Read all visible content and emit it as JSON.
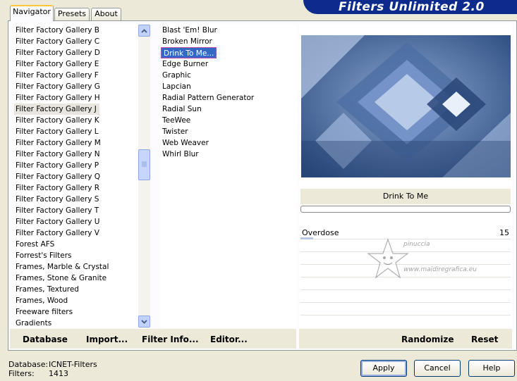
{
  "tabs": [
    "Navigator",
    "Presets",
    "About"
  ],
  "brand": "Filters Unlimited 2.0",
  "categories": [
    "Filter Factory Gallery B",
    "Filter Factory Gallery C",
    "Filter Factory Gallery D",
    "Filter Factory Gallery E",
    "Filter Factory Gallery F",
    "Filter Factory Gallery G",
    "Filter Factory Gallery H",
    "Filter Factory Gallery J",
    "Filter Factory Gallery K",
    "Filter Factory Gallery L",
    "Filter Factory Gallery M",
    "Filter Factory Gallery N",
    "Filter Factory Gallery P",
    "Filter Factory Gallery Q",
    "Filter Factory Gallery R",
    "Filter Factory Gallery S",
    "Filter Factory Gallery T",
    "Filter Factory Gallery U",
    "Filter Factory Gallery V",
    "Forest AFS",
    "Forrest's Filters",
    "Frames, Marble & Crystal",
    "Frames, Stone & Granite",
    "Frames, Textured",
    "Frames, Wood",
    "Freeware filters",
    "Gradients"
  ],
  "selected_category": "Filter Factory Gallery J",
  "filters": [
    "Blast 'Em! Blur",
    "Broken Mirror",
    "Drink To Me...",
    "Edge Burner",
    "Graphic",
    "Lapcian",
    "Radial Pattern Generator",
    "Radial Sun",
    "TeeWee",
    "Twister",
    "Web Weaver",
    "Whirl Blur"
  ],
  "selected_filter": "Drink To Me...",
  "left_buttons": {
    "database": "Database",
    "import": "Import...",
    "filter_info": "Filter Info...",
    "editor": "Editor..."
  },
  "right_buttons": {
    "randomize": "Randomize",
    "reset": "Reset"
  },
  "filter_title": "Drink To Me",
  "parameter": {
    "name": "Overdose",
    "value": "15",
    "fraction": 0.06
  },
  "watermark": {
    "line1": "pinuccia",
    "line2": "www.maidiregrafica.eu"
  },
  "status": {
    "database_label": "Database:",
    "database_value": "ICNET-Filters",
    "filters_label": "Filters:",
    "filters_value": "1413"
  },
  "dialog_buttons": {
    "apply": "Apply",
    "cancel": "Cancel",
    "help": "Help"
  },
  "colors": {
    "brand_bg": "#0c2b8c",
    "selection_blue": "#316ac5",
    "preview_base": "#3a5a8c"
  }
}
